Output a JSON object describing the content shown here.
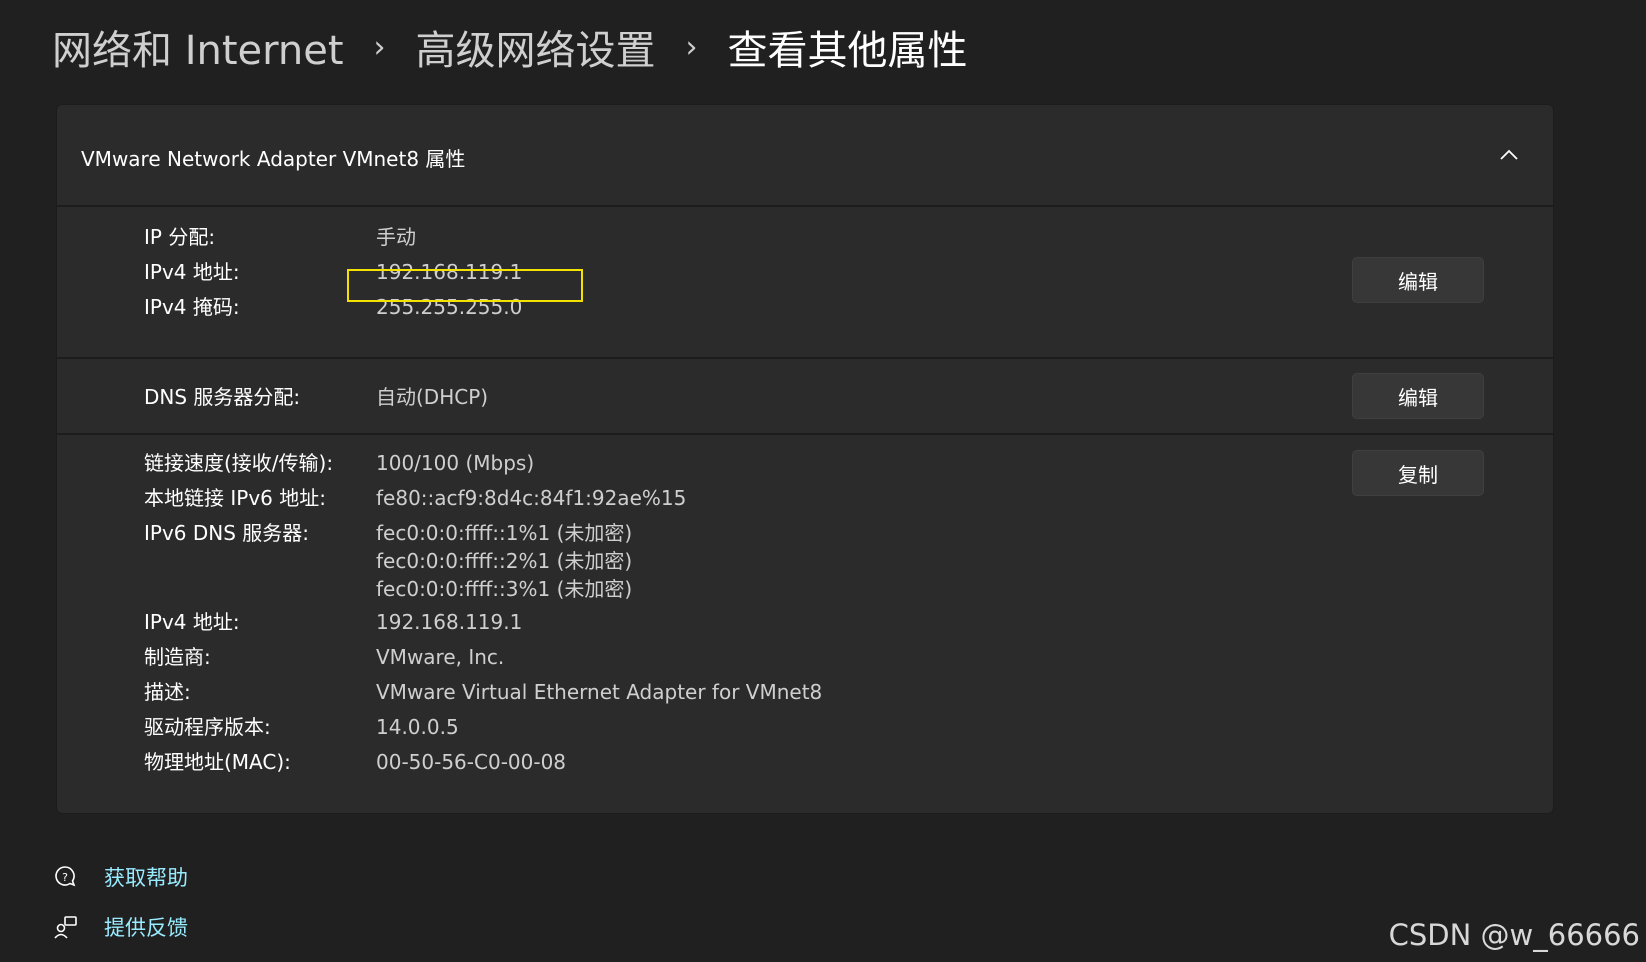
{
  "breadcrumb": {
    "items": [
      "网络和 Internet",
      "高级网络设置",
      "查看其他属性"
    ],
    "separator": "›"
  },
  "card": {
    "title": "VMware Network Adapter VMnet8 属性",
    "collapse_icon": "chevron-up-icon",
    "section_ip": {
      "rows": [
        {
          "label": "IP 分配:",
          "value": "手动"
        },
        {
          "label": "IPv4 地址:",
          "value": "192.168.119.1"
        },
        {
          "label": "IPv4 掩码:",
          "value": "255.255.255.0"
        }
      ],
      "edit_button": "编辑",
      "highlight_color": "#f5e100"
    },
    "section_dns": {
      "label": "DNS 服务器分配:",
      "value": "自动(DHCP)",
      "edit_button": "编辑"
    },
    "section_details": {
      "copy_button": "复制",
      "rows": [
        {
          "label": "链接速度(接收/传输):",
          "value": "100/100 (Mbps)"
        },
        {
          "label": "本地链接 IPv6 地址:",
          "value": "fe80::acf9:8d4c:84f1:92ae%15"
        },
        {
          "label": "IPv6 DNS 服务器:",
          "values": [
            "fec0:0:0:ffff::1%1 (未加密)",
            "fec0:0:0:ffff::2%1 (未加密)",
            "fec0:0:0:ffff::3%1 (未加密)"
          ]
        },
        {
          "label": "IPv4 地址:",
          "value": "192.168.119.1"
        },
        {
          "label": "制造商:",
          "value": "VMware, Inc."
        },
        {
          "label": "描述:",
          "value": "VMware Virtual Ethernet Adapter for VMnet8"
        },
        {
          "label": "驱动程序版本:",
          "value": "14.0.0.5"
        },
        {
          "label": "物理地址(MAC):",
          "value": "00-50-56-C0-00-08"
        }
      ]
    }
  },
  "footer": {
    "help": {
      "label": "获取帮助",
      "icon": "help-chat-icon"
    },
    "feedback": {
      "label": "提供反馈",
      "icon": "feedback-person-icon"
    }
  },
  "watermark": "CSDN @w_66666",
  "colors": {
    "background": "#202020",
    "card": "#2b2b2b",
    "link": "#99ebff",
    "button": "#373737"
  }
}
